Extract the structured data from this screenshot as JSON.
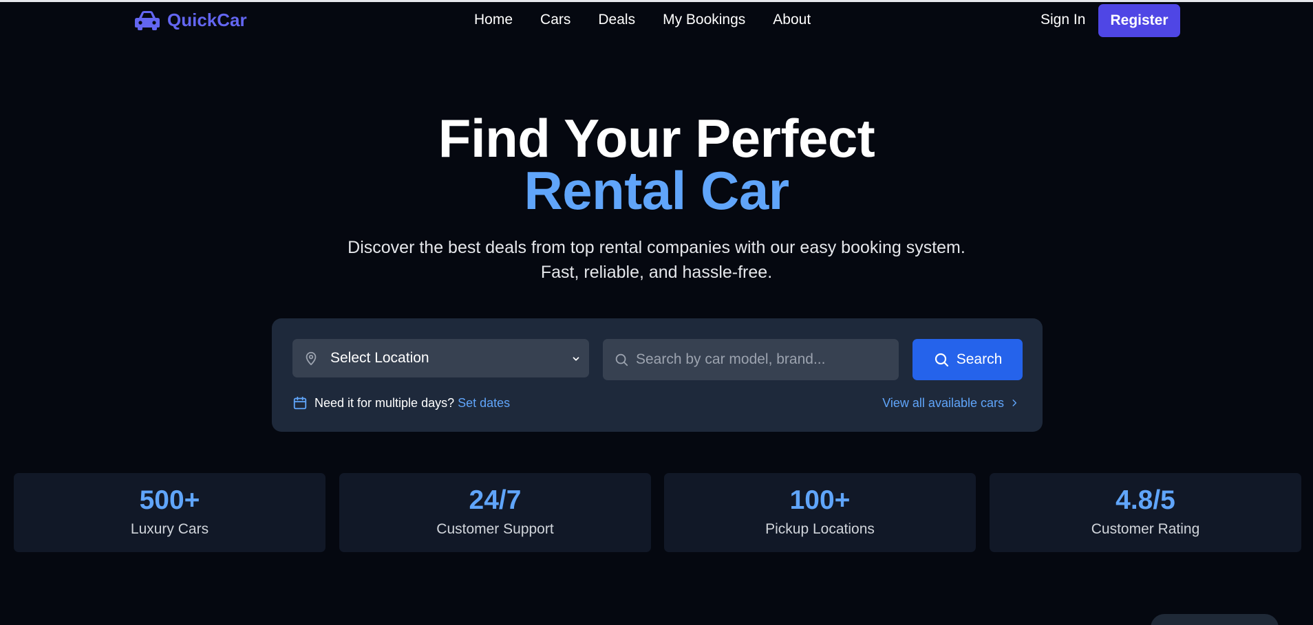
{
  "brand": {
    "name": "QuickCar",
    "accent": "#6366f1",
    "icon": "car-icon"
  },
  "nav": {
    "links": [
      "Home",
      "Cars",
      "Deals",
      "My Bookings",
      "About"
    ],
    "sign_in": "Sign In",
    "register": "Register"
  },
  "hero": {
    "line1": "Find Your Perfect",
    "line2": "Rental Car",
    "subtitle": "Discover the best deals from top rental companies with our easy booking system. Fast, reliable, and hassle-free."
  },
  "search": {
    "location_value": "Select Location",
    "location_icon": "map-pin-icon",
    "placeholder": "Search by car model, brand...",
    "search_icon": "search-icon",
    "button_label": "Search",
    "dates_prompt": "Need it for multiple days?",
    "dates_link": "Set dates",
    "dates_icon": "calendar-icon",
    "view_all": "View all available cars",
    "view_all_icon": "chevron-right-icon"
  },
  "stats": [
    {
      "value": "500+",
      "label": "Luxury Cars"
    },
    {
      "value": "24/7",
      "label": "Customer Support"
    },
    {
      "value": "100+",
      "label": "Pickup Locations"
    },
    {
      "value": "4.8/5",
      "label": "Customer Rating"
    }
  ],
  "colors": {
    "background": "#050810",
    "card": "#1e293b",
    "stat_card": "#111827",
    "highlight": "#60a5fa",
    "primary_button": "#2563eb",
    "register_button": "#4f46e5"
  }
}
